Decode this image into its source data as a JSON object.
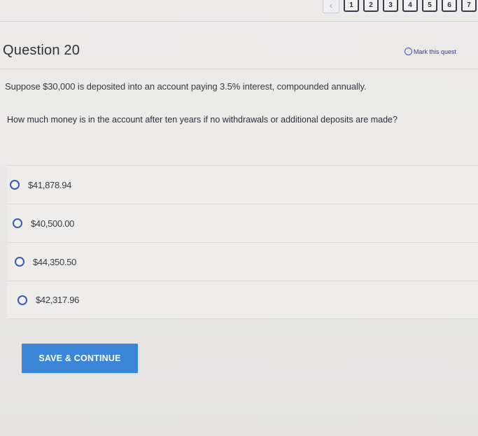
{
  "pagination": {
    "prev_icon": "chevron-left-icon",
    "pages": [
      "1",
      "2",
      "3",
      "4",
      "5",
      "6",
      "7"
    ]
  },
  "question": {
    "title": "Question 20",
    "mark_label": "Mark this quest",
    "prompt": "Suppose $30,000 is deposited into an account paying 3.5% interest, compounded annually.",
    "stem": "How much money is in the account after ten years if no withdrawals or additional deposits are made?"
  },
  "options": [
    {
      "label": "$41,878.94"
    },
    {
      "label": "$40,500.00"
    },
    {
      "label": "$44,350.50"
    },
    {
      "label": "$42,317.96"
    }
  ],
  "actions": {
    "save_label": "SAVE & CONTINUE"
  },
  "colors": {
    "accent": "#3d58b8",
    "button": "#3b86d9",
    "background": "#e9e8e7"
  }
}
